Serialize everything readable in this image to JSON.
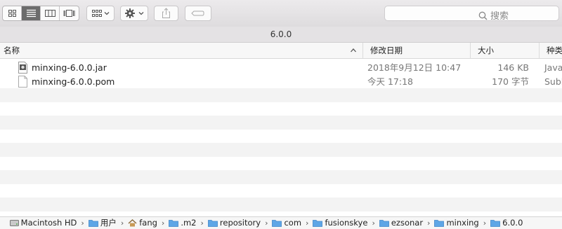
{
  "toolbar": {
    "search_placeholder": "搜索",
    "view_modes": [
      "icon-view",
      "list-view",
      "column-view",
      "cover-flow-view"
    ],
    "active_view": "list-view"
  },
  "window": {
    "folder_title": "6.0.0"
  },
  "columns": {
    "name": "名称",
    "date": "修改日期",
    "size": "大小",
    "kind": "种类"
  },
  "files": [
    {
      "name": "minxing-6.0.0.jar",
      "date": "2018年9月12日 10:47",
      "size": "146 KB",
      "kind": "Java"
    },
    {
      "name": "minxing-6.0.0.pom",
      "date": "今天 17:18",
      "size": "170 字节",
      "kind": "Subl"
    }
  ],
  "pathbar": [
    "Macintosh HD",
    "用户",
    "fang",
    ".m2",
    "repository",
    "com",
    "fusionskye",
    "ezsonar",
    "minxing",
    "6.0.0"
  ],
  "colors": {
    "folder": "#5ea6e6",
    "active_segment": "#6c6c6c",
    "row_stripe": "#f3f3f3"
  }
}
